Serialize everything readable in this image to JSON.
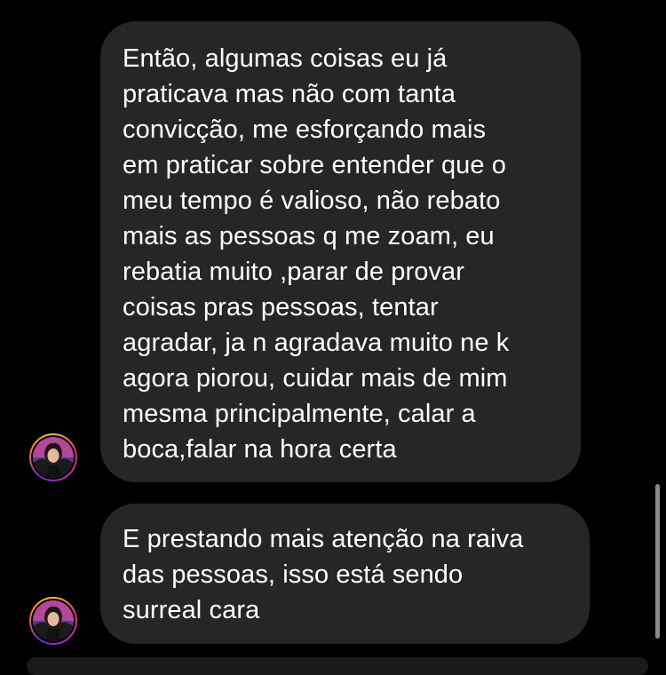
{
  "conversation": {
    "messages": [
      {
        "text": "Então, algumas coisas eu já\npraticava mas não com tanta\nconvicção, me esforçando mais\nem praticar sobre entender que o\nmeu tempo é valioso, não rebato\nmais as pessoas q me zoam, eu\nrebatia muito ,parar de provar\ncoisas pras pessoas, tentar\nagradar, ja n agradava muito ne k\nagora piorou, cuidar mais de mim\nmesma principalmente, calar a\nboca,falar na hora certa",
        "avatar": "profile-avatar-icon"
      },
      {
        "text": "E prestando mais atenção na raiva\ndas pessoas, isso está sendo\nsurreal cara",
        "avatar": "profile-avatar-icon"
      }
    ]
  },
  "colors": {
    "background": "#000000",
    "bubble": "#262626",
    "text": "#ffffff",
    "scrollbar": "#8a8a8a"
  }
}
